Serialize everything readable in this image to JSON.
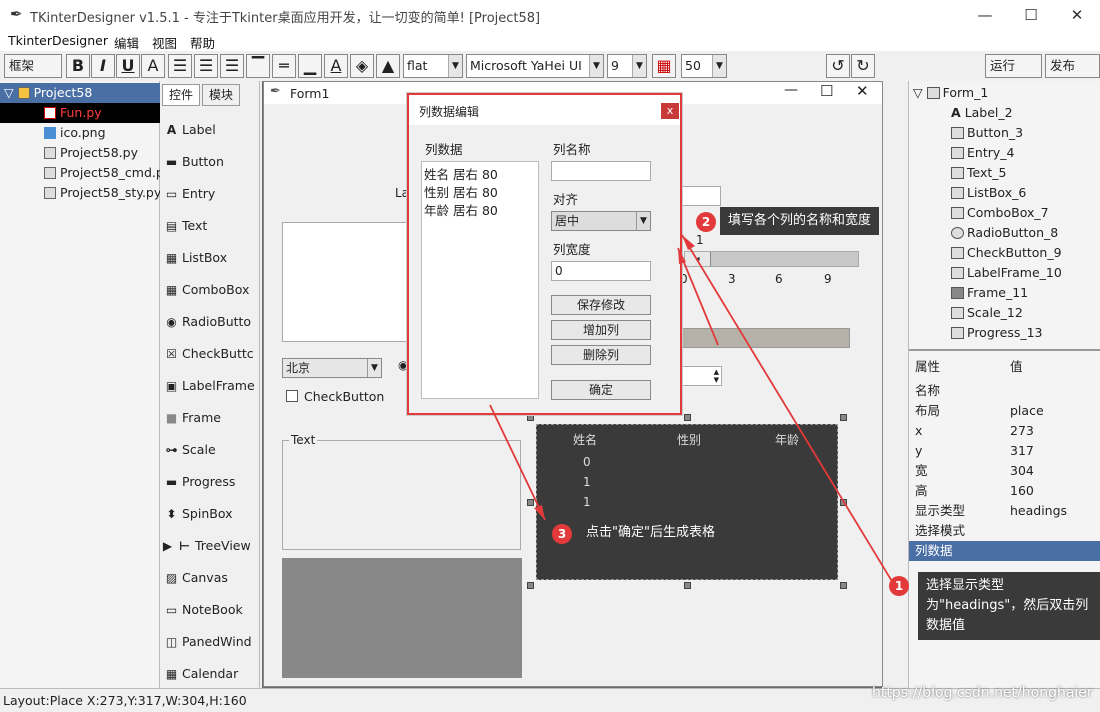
{
  "window": {
    "title": "TKinterDesigner v1.5.1 - 专注于Tkinter桌面应用开发，让一切变的简单!   [Project58]",
    "minimize": "—",
    "maximize": "☐",
    "close": "✕"
  },
  "menu": [
    "TkinterDesigner",
    "编辑",
    "视图",
    "帮助"
  ],
  "toolbar": {
    "frame_select": "框架",
    "bold": "B",
    "italic": "I",
    "underline": "U",
    "font_a": "A",
    "relief": "flat",
    "font": "Microsoft YaHei UI",
    "size": "9",
    "zoom": "50",
    "run": "运行",
    "publish": "发布"
  },
  "project_tree": [
    {
      "label": "Project58",
      "level": 0
    },
    {
      "label": "Fun.py",
      "level": 1
    },
    {
      "label": "ico.png",
      "level": 1
    },
    {
      "label": "Project58.py",
      "level": 1
    },
    {
      "label": "Project58_cmd.py",
      "level": 1
    },
    {
      "label": "Project58_sty.py",
      "level": 1
    }
  ],
  "palette": {
    "tabs": [
      "控件",
      "模块"
    ],
    "items": [
      "Label",
      "Button",
      "Entry",
      "Text",
      "ListBox",
      "ComboBox",
      "RadioButto",
      "CheckButtc",
      "LabelFrame",
      "Frame",
      "Scale",
      "Progress",
      "SpinBox",
      "TreeView",
      "Canvas",
      "NoteBook",
      "PanedWind",
      "Calendar"
    ]
  },
  "form": {
    "title": "Form1",
    "label_partial": "Lal",
    "combo_value": "北京",
    "checkbutton": "CheckButton",
    "labelframe": "Text",
    "scale_value": "1",
    "scale_ticks": [
      "0",
      "3",
      "6",
      "9"
    ],
    "tree_headings": [
      "姓名",
      "性别",
      "年龄"
    ],
    "tree_rows": [
      "0",
      "1",
      "1"
    ]
  },
  "dialog": {
    "title": "列数据编辑",
    "close": "x",
    "list_label": "列数据",
    "list_items": [
      "姓名 居右 80",
      "性别 居右 80",
      "年龄 居右 80"
    ],
    "name_label": "列名称",
    "name_value": "",
    "align_label": "对齐",
    "align_value": "居中",
    "width_label": "列宽度",
    "width_value": "0",
    "save": "保存修改",
    "add": "增加列",
    "delete": "删除列",
    "ok": "确定"
  },
  "widget_tree": [
    "Form_1",
    "Label_2",
    "Button_3",
    "Entry_4",
    "Text_5",
    "ListBox_6",
    "ComboBox_7",
    "RadioButton_8",
    "CheckButton_9",
    "LabelFrame_10",
    "Frame_11",
    "Scale_12",
    "Progress_13"
  ],
  "properties": {
    "header_name": "属性",
    "header_value": "值",
    "rows": [
      {
        "name": "名称",
        "value": ""
      },
      {
        "name": "布局",
        "value": "place"
      },
      {
        "name": "x",
        "value": "273"
      },
      {
        "name": "y",
        "value": "317"
      },
      {
        "name": "宽",
        "value": "304"
      },
      {
        "name": "高",
        "value": "160"
      },
      {
        "name": "显示类型",
        "value": "headings"
      },
      {
        "name": "选择模式",
        "value": ""
      },
      {
        "name": "列数据",
        "value": ""
      }
    ]
  },
  "annotations": {
    "one_badge": "1",
    "one_text": "选择显示类型为\"headings\"，然后双击列数据值",
    "two_badge": "2",
    "two_text": "填写各个列的名称和宽度",
    "three_badge": "3",
    "three_text": "点击\"确定\"后生成表格"
  },
  "status": "Layout:Place  X:273,Y:317,W:304,H:160",
  "watermark": "https://blog.csdn.net/honghaier",
  "colors": {
    "accent_red": "#e23a3a",
    "tree_bg": "#3a3a3a",
    "selected_row": "#4a6fa5"
  }
}
